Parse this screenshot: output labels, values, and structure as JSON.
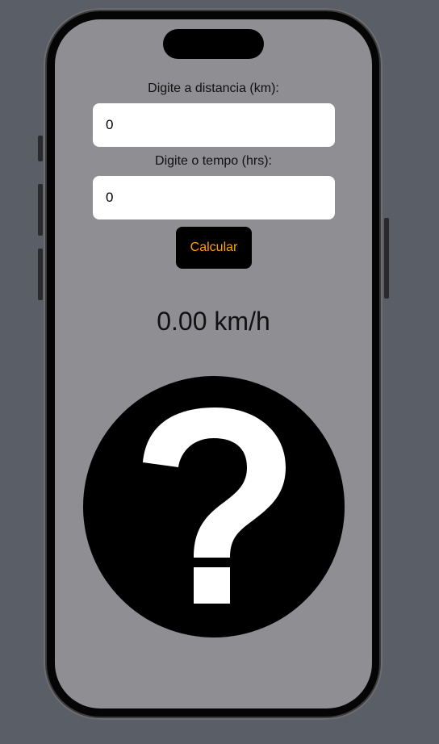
{
  "distance": {
    "label": "Digite a distancia (km):",
    "value": "0"
  },
  "time": {
    "label": "Digite o tempo (hrs):",
    "value": "0"
  },
  "calculate_button": {
    "label": "Calcular"
  },
  "result": {
    "speed_text": "0.00 km/h"
  },
  "status_image": {
    "icon": "question-circle-icon"
  },
  "colors": {
    "background": "#5a5e66",
    "screen": "#8e8e93",
    "button_bg": "#000000",
    "button_text": "#ff9f0a",
    "field_bg": "#ffffff"
  }
}
